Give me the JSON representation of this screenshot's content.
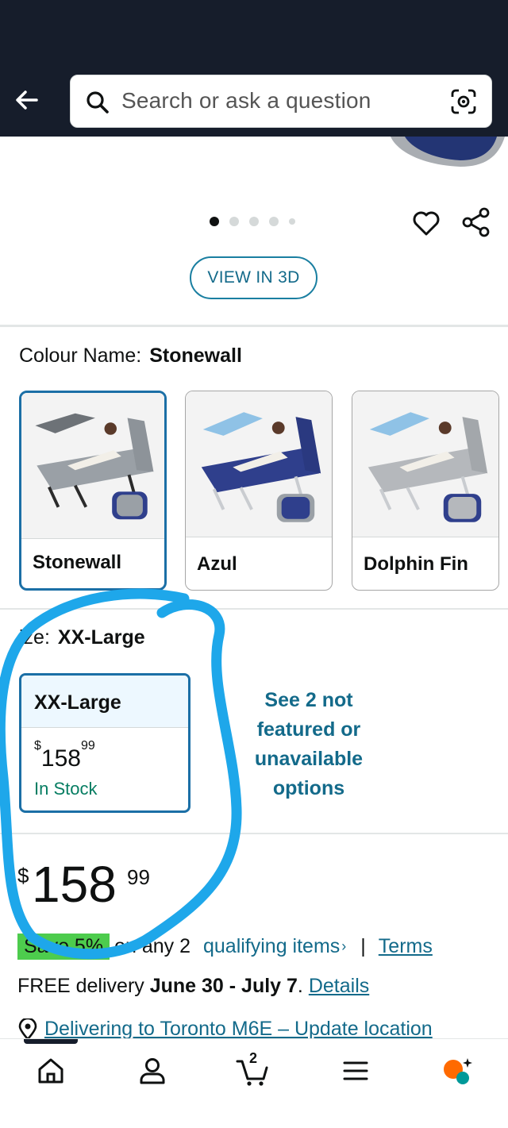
{
  "header": {
    "search_placeholder": "Search or ask a question"
  },
  "gallery": {
    "view_3d_label": "VIEW IN 3D"
  },
  "colour": {
    "label": "Colour Name:",
    "selected": "Stonewall",
    "options": [
      {
        "name": "Stonewall",
        "cushion": "#9aa0a6",
        "frame": "#2b2b2b"
      },
      {
        "name": "Azul",
        "cushion": "#2f3f8c",
        "frame": "#8fc2e6"
      },
      {
        "name": "Dolphin Fin",
        "cushion": "#b5b8bc",
        "frame": "#8fc2e6"
      }
    ]
  },
  "size": {
    "label": "ize:",
    "selected": "XX-Large",
    "card_title": "XX-Large",
    "card_price_currency": "$",
    "card_price_whole": "158",
    "card_price_fraction": "99",
    "card_stock": "In Stock",
    "see_more": "See 2 not featured or unavailable options"
  },
  "price": {
    "currency": "$",
    "whole": "158",
    "fraction": "99"
  },
  "promo": {
    "badge": "Save 5%",
    "text": "on any 2",
    "link": "qualifying items",
    "chevron": "›",
    "separator": "|",
    "terms": "Terms"
  },
  "delivery": {
    "prefix": "FREE delivery",
    "dates": "June 30 - July 7",
    "period": ".",
    "details": "Details"
  },
  "location": {
    "text": "Delivering to Toronto M6E – Update location"
  },
  "bottom_nav": {
    "cart_count": "2",
    "items": [
      "home-icon",
      "account-icon",
      "cart-icon",
      "menu-icon",
      "rufus-icon"
    ]
  },
  "colors": {
    "header_bg": "#161d2b",
    "link": "#136a8a",
    "selected_border": "#1b6fa6",
    "in_stock": "#067d62",
    "save_badge": "#4dcc4d",
    "annotation": "#1ea7ea"
  }
}
